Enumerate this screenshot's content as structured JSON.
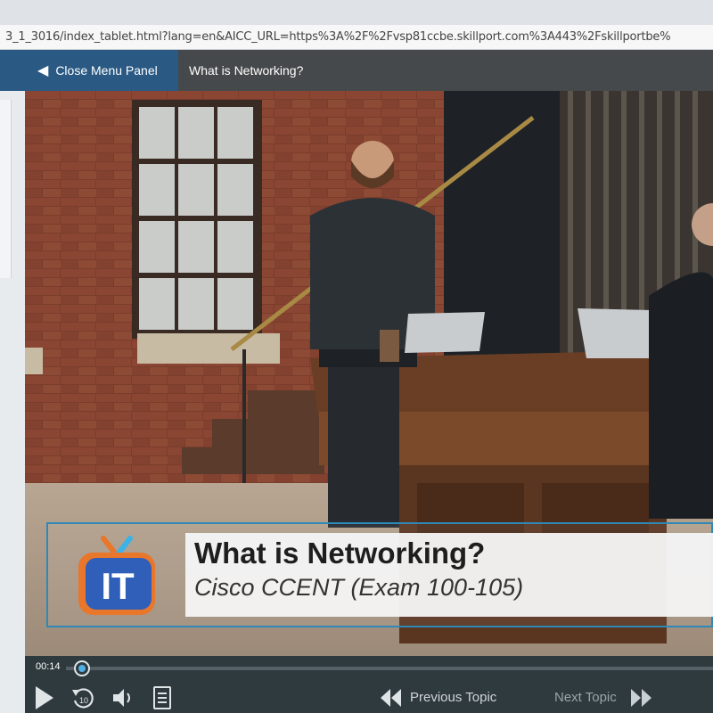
{
  "browser": {
    "url": "3_1_3016/index_tablet.html?lang=en&AICC_URL=https%3A%2F%2Fvsp81ccbe.skillport.com%3A443%2Fskillportbe%"
  },
  "header": {
    "close_menu_label": "Close Menu Panel",
    "page_title": "What is Networking?"
  },
  "video": {
    "lower_third": {
      "title": "What is Networking?",
      "subtitle": "Cisco CCENT (Exam 100-105)",
      "logo_text": "IT"
    }
  },
  "player": {
    "elapsed": "00:14",
    "skip_back_seconds": "10",
    "previous_topic": "Previous Topic",
    "next_topic": "Next Topic"
  },
  "colors": {
    "accent_blue": "#2a5a84",
    "progress_blue": "#4fb0e6",
    "lower_third_border": "#2e88b8"
  }
}
